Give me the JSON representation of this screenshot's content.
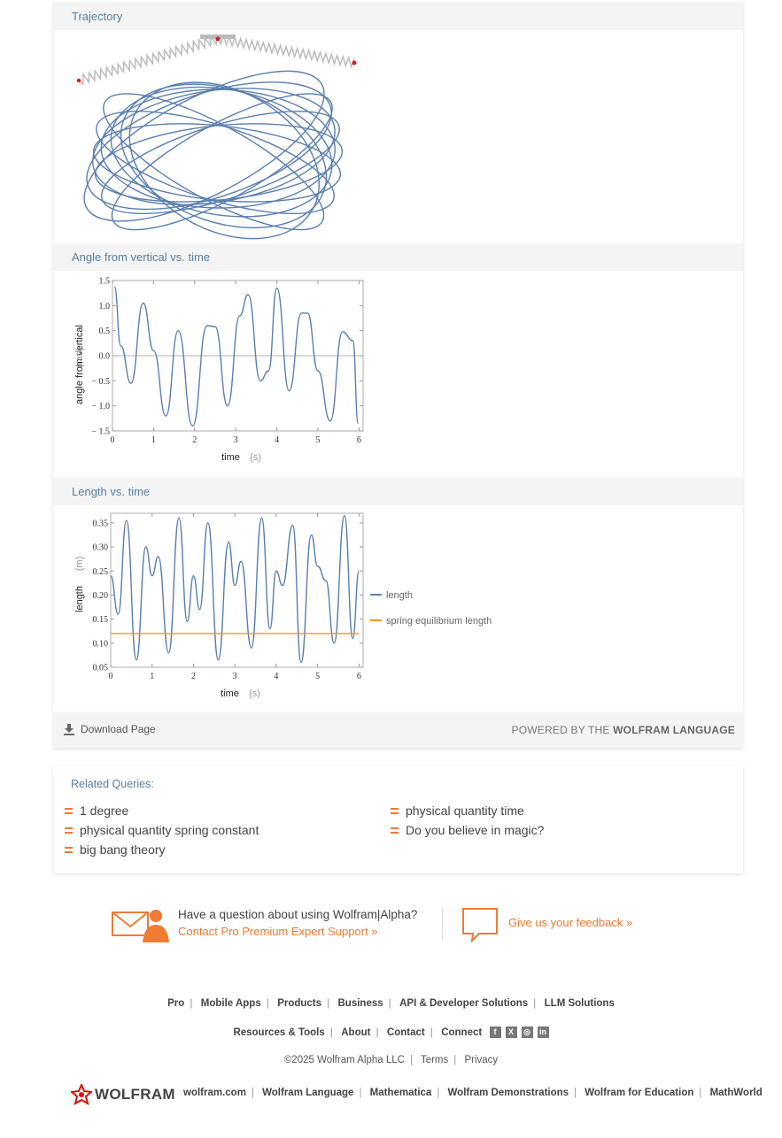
{
  "pods": {
    "trajectory": {
      "title": "Trajectory"
    },
    "angle": {
      "title": "Angle from vertical vs. time"
    },
    "length": {
      "title": "Length vs. time"
    }
  },
  "chart_data": [
    {
      "type": "line",
      "title": "",
      "xlabel": "time",
      "xunit": "(s)",
      "ylabel": "angle from vertical",
      "yunit": "(rad)",
      "xlim": [
        0,
        6.1
      ],
      "ylim": [
        -1.5,
        1.5
      ],
      "xticks": [
        0,
        1,
        2,
        3,
        4,
        5,
        6
      ],
      "yticks": [
        -1.5,
        -1.0,
        -0.5,
        0.0,
        0.5,
        1.0,
        1.5
      ],
      "ytick_labels": [
        "-1.5",
        "-1.0",
        "-0.5",
        "0.0",
        "0.5",
        "1.0",
        "1.5"
      ],
      "series": [
        {
          "color": "#5b7fae",
          "x": [
            0.05,
            0.2,
            0.45,
            0.75,
            1.0,
            1.3,
            1.6,
            1.95,
            2.3,
            2.5,
            2.8,
            3.1,
            3.3,
            3.6,
            3.8,
            4.0,
            4.3,
            4.6,
            4.75,
            5.0,
            5.3,
            5.6,
            5.85,
            5.98
          ],
          "y": [
            1.38,
            0.2,
            -0.55,
            1.05,
            0.1,
            -1.2,
            0.5,
            -1.4,
            0.6,
            0.58,
            -1.0,
            0.8,
            1.22,
            -0.5,
            -0.3,
            1.35,
            -0.7,
            0.85,
            0.85,
            -0.3,
            -1.3,
            0.48,
            0.3,
            -1.35
          ]
        }
      ]
    },
    {
      "type": "line",
      "title": "",
      "xlabel": "time",
      "xunit": "(s)",
      "ylabel": "length",
      "yunit": "(m)",
      "xlim": [
        0,
        6.1
      ],
      "ylim": [
        0.05,
        0.37
      ],
      "xticks": [
        0,
        1,
        2,
        3,
        4,
        5,
        6
      ],
      "yticks": [
        0.05,
        0.1,
        0.15,
        0.2,
        0.25,
        0.3,
        0.35
      ],
      "ytick_labels": [
        "0.05",
        "0.10",
        "0.15",
        "0.20",
        "0.25",
        "0.30",
        "0.35"
      ],
      "series": [
        {
          "name": "length",
          "color": "#5b7fae",
          "x": [
            0.0,
            0.18,
            0.38,
            0.62,
            0.85,
            1.0,
            1.15,
            1.4,
            1.65,
            1.85,
            2.0,
            2.15,
            2.35,
            2.6,
            2.85,
            3.0,
            3.15,
            3.4,
            3.65,
            3.85,
            4.0,
            4.15,
            4.4,
            4.6,
            4.85,
            5.0,
            5.2,
            5.4,
            5.65,
            5.85,
            6.0
          ],
          "y": [
            0.24,
            0.16,
            0.355,
            0.065,
            0.3,
            0.24,
            0.28,
            0.08,
            0.36,
            0.145,
            0.24,
            0.17,
            0.35,
            0.065,
            0.31,
            0.22,
            0.27,
            0.09,
            0.36,
            0.13,
            0.25,
            0.22,
            0.345,
            0.06,
            0.325,
            0.26,
            0.23,
            0.1,
            0.365,
            0.11,
            0.25
          ]
        },
        {
          "name": "spring equilibrium length",
          "color": "#f0922a",
          "x": [
            0,
            6.0
          ],
          "y": [
            0.12,
            0.12
          ]
        }
      ],
      "legend": "right"
    }
  ],
  "footer": {
    "download_label": "Download Page",
    "powered_prefix": "POWERED BY THE ",
    "powered_brand": "WOLFRAM LANGUAGE"
  },
  "related": {
    "title": "Related Queries:",
    "items": [
      "1 degree",
      "physical quantity spring constant",
      "big bang theory",
      "physical quantity time",
      "Do you believe in magic?"
    ]
  },
  "help": {
    "question": "Have a question about using Wolfram|Alpha?",
    "contact": "Contact Pro Premium Expert Support »",
    "feedback": "Give us your feedback »"
  },
  "links": {
    "row1": [
      "Pro",
      "Mobile Apps",
      "Products",
      "Business",
      "API & Developer Solutions",
      "LLM Solutions"
    ],
    "row2": [
      "Resources & Tools",
      "About",
      "Contact",
      "Connect"
    ],
    "copyright": "©2025  Wolfram Alpha LLC",
    "terms": "Terms",
    "privacy": "Privacy",
    "brand": "WOLFRAM",
    "row4": [
      "wolfram.com",
      "Wolfram Language",
      "Mathematica",
      "Wolfram Demonstrations",
      "Wolfram for Education",
      "MathWorld"
    ]
  }
}
